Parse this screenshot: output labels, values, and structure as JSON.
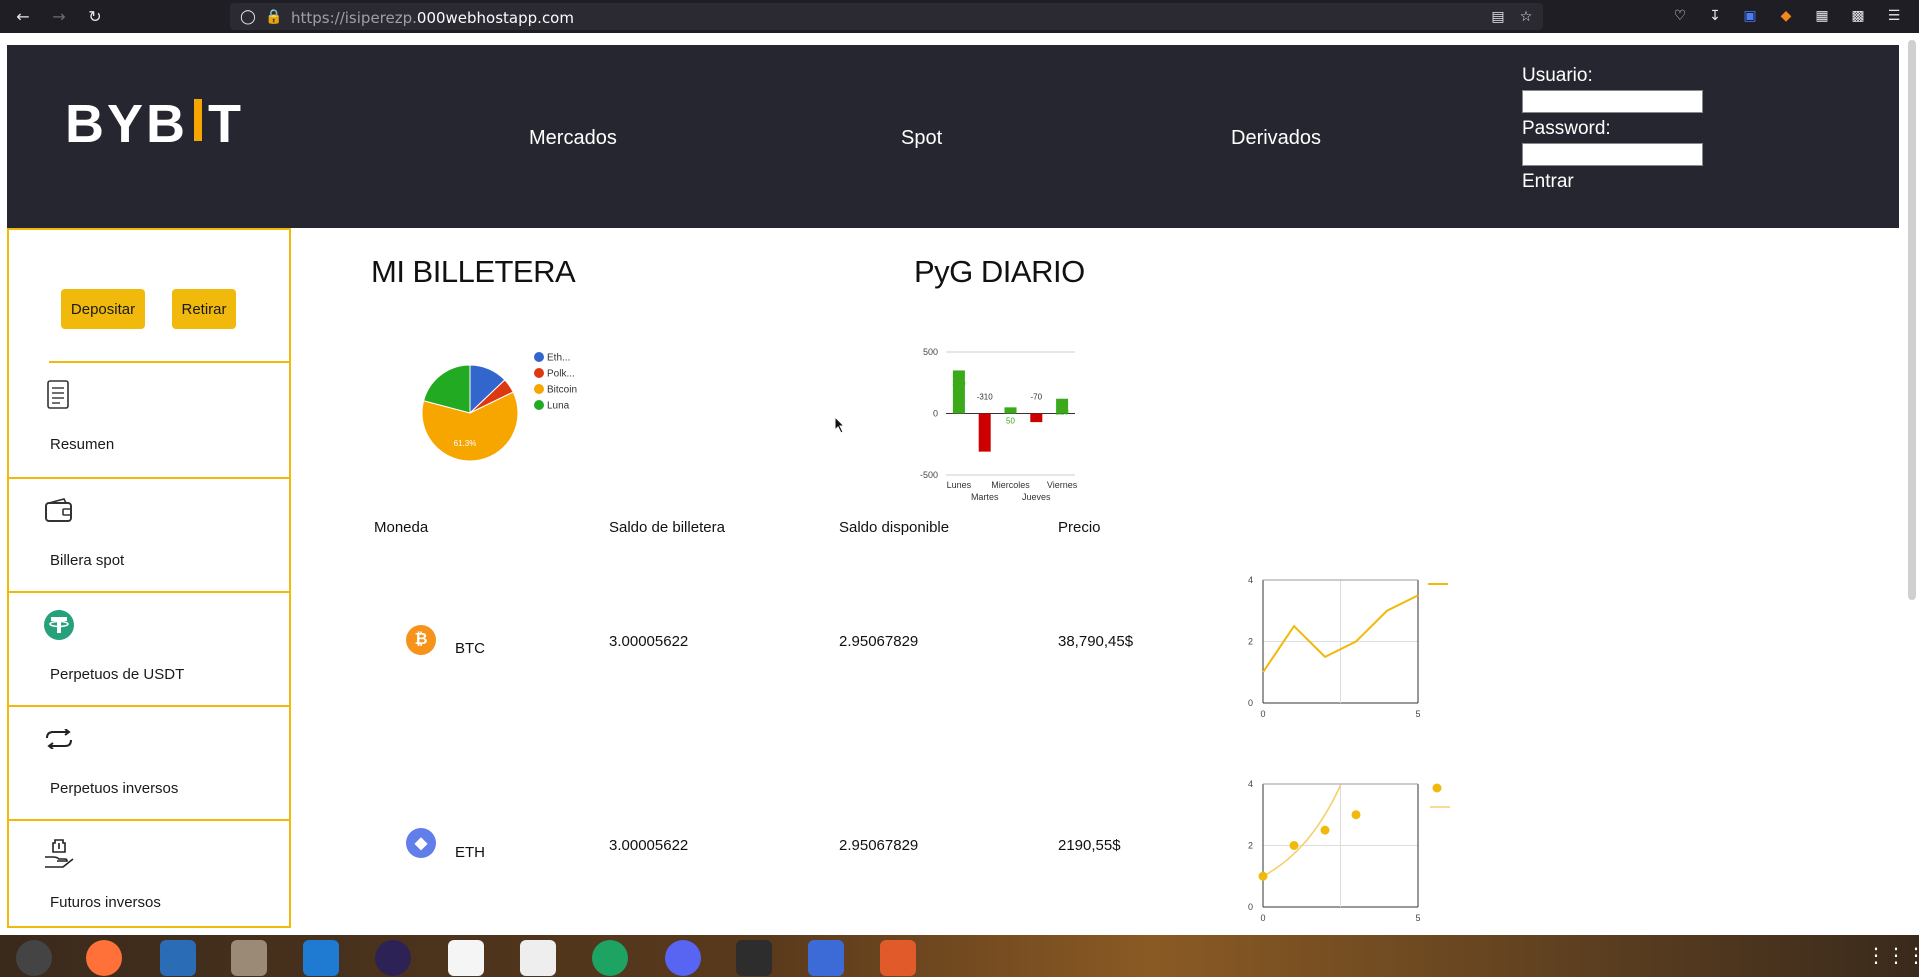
{
  "browser": {
    "url_prefix": "https://isiperezp.",
    "url_domain": "000webhostapp.com"
  },
  "header": {
    "logo_left": "BYB",
    "logo_right": "T",
    "nav": [
      "Mercados",
      "Spot",
      "Derivados"
    ],
    "login": {
      "user_label": "Usuario:",
      "password_label": "Password:",
      "submit_label": "Entrar"
    }
  },
  "sidebar": {
    "deposit_label": "Depositar",
    "withdraw_label": "Retirar",
    "items": [
      {
        "label": "Resumen",
        "icon": "document-list-icon"
      },
      {
        "label": "Billera spot",
        "icon": "wallet-icon"
      },
      {
        "label": "Perpetuos de USDT",
        "icon": "tether-icon"
      },
      {
        "label": "Perpetuos inversos",
        "icon": "swap-arrows-icon"
      },
      {
        "label": "Futuros inversos",
        "icon": "hand-bank-icon"
      }
    ]
  },
  "wallet": {
    "title": "MI BILLETERA",
    "pie_label": "61.3%"
  },
  "pnl": {
    "title": "PyG DIARIO"
  },
  "table": {
    "headers": [
      "Moneda",
      "Saldo de billetera",
      "Saldo disponible",
      "Precio"
    ],
    "rows": [
      {
        "coin": "BTC",
        "wallet_balance": "3.00005622",
        "available": "2.95067829",
        "price": "38,790,45$"
      },
      {
        "coin": "ETH",
        "wallet_balance": "3.00005622",
        "available": "2.95067829",
        "price": "2190,55$"
      }
    ]
  },
  "colors": {
    "accent": "#f0b90b",
    "header_bg": "#262630",
    "positive": "#3aaa1a",
    "negative": "#cc0000",
    "eth": "#3366cc",
    "polk": "#dc3912",
    "btc": "#f7a600",
    "luna": "#22aa22"
  },
  "chart_data": [
    {
      "type": "pie",
      "labels": [
        "Eth...",
        "Polk...",
        "Bitcoin",
        "Luna"
      ],
      "values": [
        12.9,
        4.9,
        61.3,
        20.9
      ],
      "slice_label": "61.3%",
      "legend": "right"
    },
    {
      "type": "bar",
      "categories": [
        "Lunes",
        "Martes",
        "Miercoles",
        "Jueves",
        "Viernes"
      ],
      "values": [
        350,
        -310,
        50,
        -70,
        120
      ],
      "ylim": [
        -500,
        500
      ],
      "yticks": [
        500,
        0,
        -500
      ],
      "grid": true
    },
    {
      "type": "line",
      "x": [
        0,
        1,
        2,
        3,
        4,
        5
      ],
      "y": [
        1,
        2.5,
        1.5,
        2,
        3,
        3.5
      ],
      "xticks": [
        0,
        5
      ],
      "yticks": [
        0,
        2,
        4
      ],
      "ylim": [
        0,
        4
      ],
      "grid": true
    },
    {
      "type": "scatter",
      "x": [
        0,
        1,
        2,
        3
      ],
      "y": [
        1,
        2,
        2.5,
        3
      ],
      "trend": "exponential",
      "xticks": [
        0,
        5
      ],
      "yticks": [
        0,
        2,
        4
      ],
      "ylim": [
        0,
        4
      ],
      "grid": true
    }
  ]
}
